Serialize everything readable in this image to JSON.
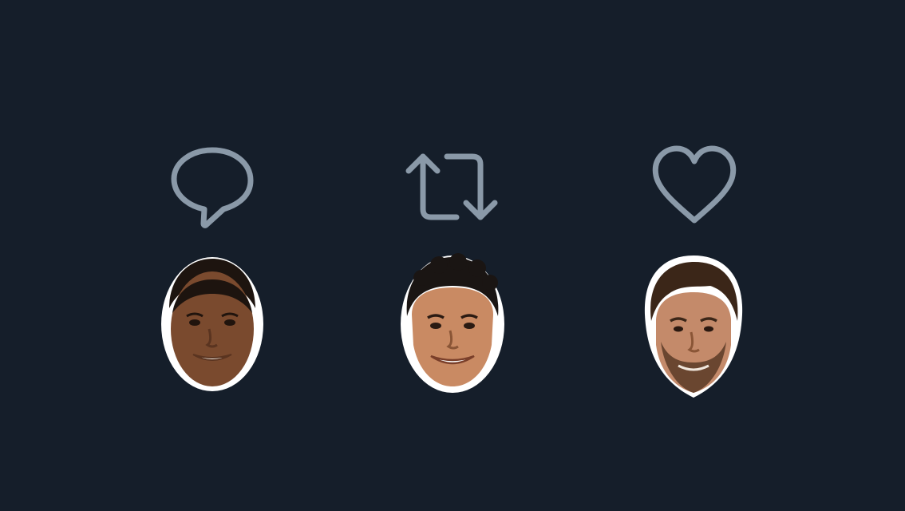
{
  "actions": [
    {
      "icon": "reply-icon",
      "state": "default"
    },
    {
      "icon": "retweet-icon",
      "state": "default"
    },
    {
      "icon": "like-icon",
      "state": "default"
    }
  ],
  "colors": {
    "background": "#151e2a",
    "icon_stroke": "#8a99a8",
    "sticker_border": "#ffffff"
  },
  "faces": [
    {
      "position": "under-reply"
    },
    {
      "position": "under-retweet"
    },
    {
      "position": "under-like"
    }
  ]
}
